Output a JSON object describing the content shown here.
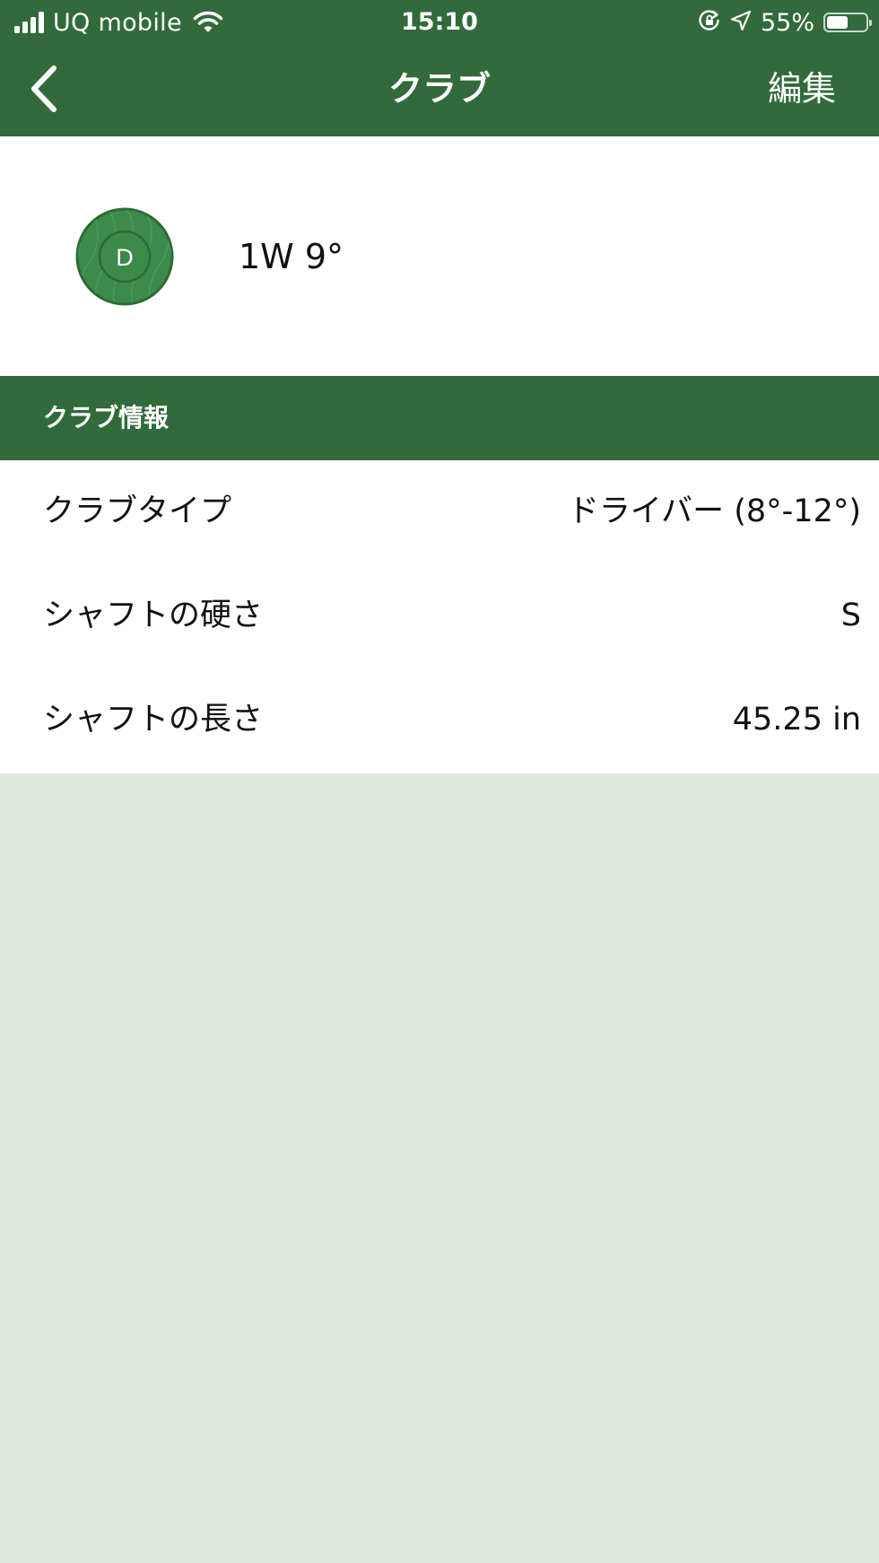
{
  "status_bar": {
    "carrier": "UQ mobile",
    "time": "15:10",
    "battery_percent": "55%",
    "battery_level": 0.55
  },
  "nav": {
    "title": "クラブ",
    "edit_label": "編集",
    "back_icon": "chevron-left-icon"
  },
  "club": {
    "icon_letter": "D",
    "name": "1W 9°"
  },
  "section": {
    "title": "クラブ情報"
  },
  "info_rows": [
    {
      "label": "クラブタイプ",
      "value": "ドライバー (8°-12°)"
    },
    {
      "label": "シャフトの硬さ",
      "value": "S"
    },
    {
      "label": "シャフトの長さ",
      "value": "45.25 in"
    }
  ],
  "colors": {
    "header_green": "#326a3c",
    "background": "#dee8df",
    "icon_green": "#3d8a4b"
  }
}
